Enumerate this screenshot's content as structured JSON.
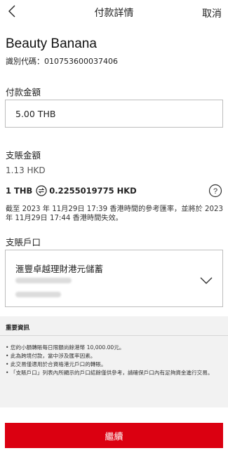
{
  "header": {
    "title": "付款詳情",
    "cancel_label": "取消"
  },
  "merchant": {
    "name": "Beauty Banana",
    "id_label": "識別代碼：010753600037406"
  },
  "payment": {
    "label": "付款金額",
    "amount_value": "5.00 THB"
  },
  "debit": {
    "label": "支賬金額",
    "amount": "1.13 HKD",
    "rate_from": "1 THB",
    "rate_to": "0.2255019775 HKD",
    "rate_note": "截至 2023 年 11月29日 17:39 香港時間的參考匯率，並將於 2023 年 11月29日 17:44 香港時間失效。"
  },
  "account": {
    "label": "支賬戶口",
    "name": "滙豐卓越理財港元儲蓄"
  },
  "info": {
    "title": "重要資訊",
    "items": [
      "• 您的小額轉賬每日限額尚餘港幣 10,000.00元。",
      "• 此為跨境付款，當中涉及匯率因素。",
      "• 此交易僅適用於合資格港元戶口的轉賬。",
      "• 「支賬戶口」列表內所顯示的戶口結餘僅供參考，請確保戶口內有足夠資金進行交易。"
    ]
  },
  "actions": {
    "continue_label": "繼續"
  },
  "colors": {
    "accent": "#db0011",
    "info_bg": "#f2f2f2",
    "border": "#bdbdbd"
  },
  "icons": {
    "back": "chevron-left-icon",
    "swap": "swap-icon",
    "help": "help-icon",
    "dropdown": "chevron-down-icon"
  }
}
